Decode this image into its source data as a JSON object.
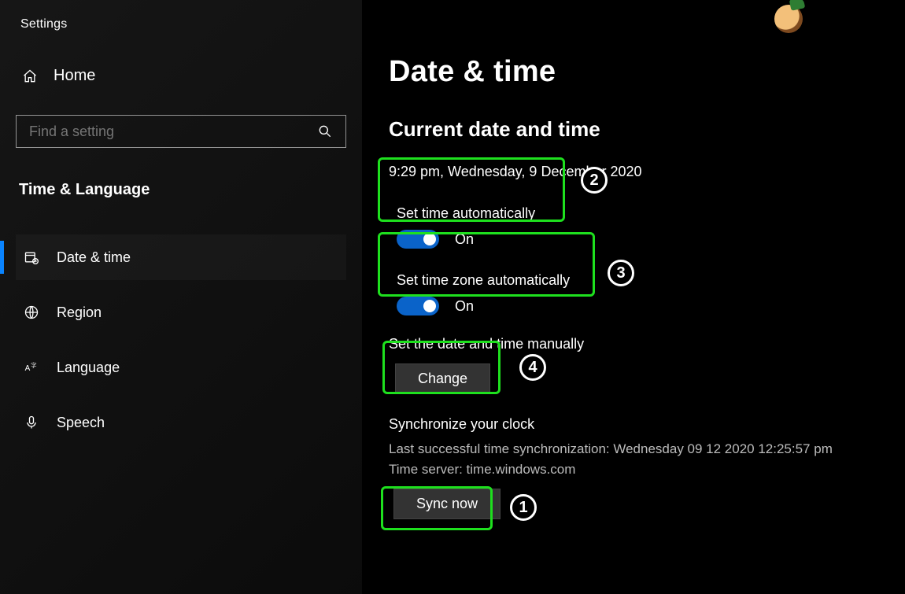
{
  "app_title": "Settings",
  "home_label": "Home",
  "search": {
    "placeholder": "Find a setting"
  },
  "category": "Time & Language",
  "nav": [
    {
      "label": "Date & time",
      "selected": true
    },
    {
      "label": "Region"
    },
    {
      "label": "Language"
    },
    {
      "label": "Speech"
    }
  ],
  "page": {
    "heading": "Date & time",
    "current_section": "Current date and time",
    "current_datetime": "9:29 pm, Wednesday, 9 December 2020",
    "set_time_auto": {
      "label": "Set time automatically",
      "state": "On"
    },
    "set_tz_auto": {
      "label": "Set time zone automatically",
      "state": "On"
    },
    "manual": {
      "label": "Set the date and time manually",
      "button": "Change"
    },
    "sync": {
      "label": "Synchronize your clock",
      "last": "Last successful time synchronization: Wednesday 09 12 2020 12:25:57 pm",
      "server": "Time server: time.windows.com",
      "button": "Sync now"
    }
  },
  "annotations": {
    "n1": "1",
    "n2": "2",
    "n3": "3",
    "n4": "4"
  }
}
